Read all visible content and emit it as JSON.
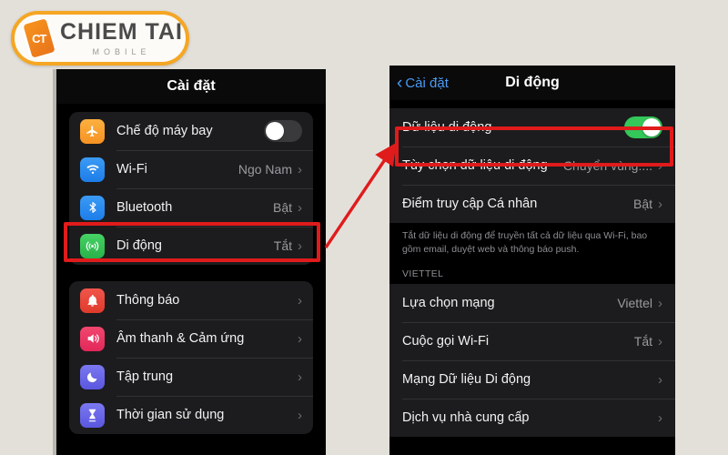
{
  "logo": {
    "mark_text": "CT",
    "name": "CHIEM TAI",
    "tagline": "MOBILE",
    "border_color": "#f5a623",
    "mark_color": "#f7941e"
  },
  "colors": {
    "background": "#e3e0da",
    "highlight": "#e01b1b",
    "accent_blue": "#4a9bf5",
    "toggle_on": "#34c759",
    "toggle_off": "#3a3a3c"
  },
  "left_phone": {
    "navbar": {
      "title": "Cài đặt"
    },
    "group1": [
      {
        "label": "Chế độ máy bay",
        "icon": "airplane-icon",
        "control": "toggle",
        "toggle_state": "off"
      },
      {
        "label": "Wi-Fi",
        "icon": "wifi-icon",
        "value": "Ngo Nam",
        "chevron": "›"
      },
      {
        "label": "Bluetooth",
        "icon": "bluetooth-icon",
        "value": "Bật",
        "chevron": "›"
      },
      {
        "label": "Di động",
        "icon": "cellular-icon",
        "value": "Tắt",
        "chevron": "›",
        "highlighted": true
      }
    ],
    "group2": [
      {
        "label": "Thông báo",
        "icon": "notifications-icon",
        "value": "",
        "chevron": "›"
      },
      {
        "label": "Âm thanh & Cảm ứng",
        "icon": "sound-icon",
        "value": "",
        "chevron": "›"
      },
      {
        "label": "Tập trung",
        "icon": "focus-moon-icon",
        "value": "",
        "chevron": "›"
      },
      {
        "label": "Thời gian sử dụng",
        "icon": "screen-time-hourglass-icon",
        "value": "",
        "chevron": "›"
      }
    ]
  },
  "right_phone": {
    "navbar": {
      "back_label": "Cài đặt",
      "back_chevron": "‹",
      "title": "Di động"
    },
    "rows_top": [
      {
        "label": "Dữ liệu di động",
        "control": "toggle",
        "toggle_state": "on",
        "highlighted": true
      },
      {
        "label": "Tùy chọn dữ liệu di động",
        "value": "Chuyển vùng:...",
        "chevron": "›"
      },
      {
        "label": "Điểm truy cập Cá nhân",
        "value": "Bật",
        "chevron": "›"
      }
    ],
    "footnote": "Tắt dữ liệu di động để truyền tất cả dữ liệu qua Wi-Fi, bao gồm email, duyệt web và thông báo push.",
    "section_header": "VIETTEL",
    "rows_carrier": [
      {
        "label": "Lựa chọn mạng",
        "value": "Viettel",
        "chevron": "›"
      },
      {
        "label": "Cuộc gọi Wi-Fi",
        "value": "Tắt",
        "chevron": "›"
      },
      {
        "label": "Mạng Dữ liệu Di động",
        "value": "",
        "chevron": "›"
      },
      {
        "label": "Dịch vụ nhà cung cấp",
        "value": "",
        "chevron": "›"
      }
    ]
  },
  "annotation": {
    "arrow_description": "red-arrow-from-di-dong-to-du-lieu-di-dong"
  }
}
